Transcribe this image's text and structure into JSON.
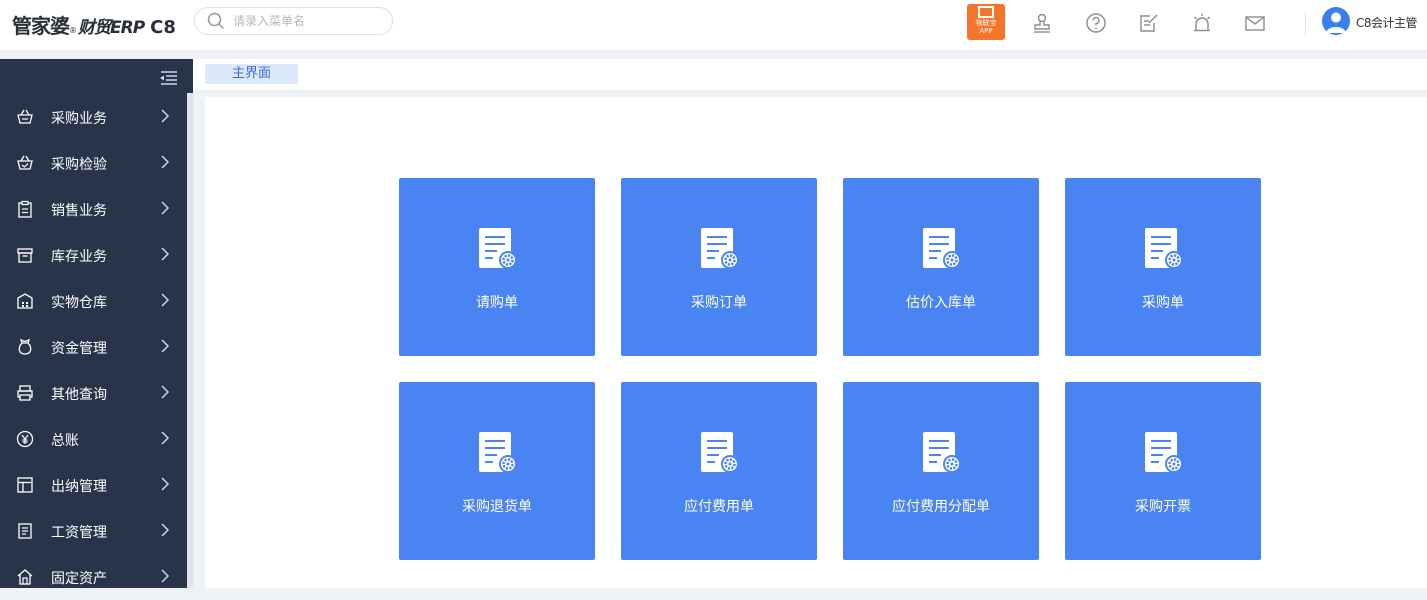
{
  "brand": {
    "name_cn": "管家婆",
    "registered": "®",
    "product": "财贸ERP",
    "edition": "C8"
  },
  "search": {
    "placeholder": "请录入菜单名"
  },
  "header": {
    "app_badge": {
      "line1": "物联宝",
      "line2": "APP"
    },
    "icons": [
      "stamp-icon",
      "help-icon",
      "edit-note-icon",
      "alarm-icon",
      "mail-icon"
    ],
    "user": "C8会计主管"
  },
  "sidebar": {
    "items": [
      {
        "label": "采购业务",
        "icon": "basket-icon"
      },
      {
        "label": "采购检验",
        "icon": "basket-check-icon"
      },
      {
        "label": "销售业务",
        "icon": "clipboard-icon"
      },
      {
        "label": "库存业务",
        "icon": "box-icon"
      },
      {
        "label": "实物仓库",
        "icon": "warehouse-icon"
      },
      {
        "label": "资金管理",
        "icon": "money-bag-icon"
      },
      {
        "label": "其他查询",
        "icon": "printer-icon"
      },
      {
        "label": "总账",
        "icon": "yen-icon"
      },
      {
        "label": "出纳管理",
        "icon": "layout-icon"
      },
      {
        "label": "工资管理",
        "icon": "payroll-icon"
      },
      {
        "label": "固定资产",
        "icon": "house-icon"
      }
    ]
  },
  "tabs": [
    {
      "label": "主界面"
    }
  ],
  "cards": [
    {
      "label": "请购单"
    },
    {
      "label": "采购订单"
    },
    {
      "label": "估价入库单"
    },
    {
      "label": "采购单"
    },
    {
      "label": "采购退货单"
    },
    {
      "label": "应付费用单"
    },
    {
      "label": "应付费用分配单"
    },
    {
      "label": "采购开票"
    }
  ],
  "colors": {
    "sidebar_bg": "#273449",
    "card_bg": "#4a84f2",
    "accent": "#3a7ef0",
    "badge": "#f3742a",
    "tab_bg": "#dde8fb"
  }
}
